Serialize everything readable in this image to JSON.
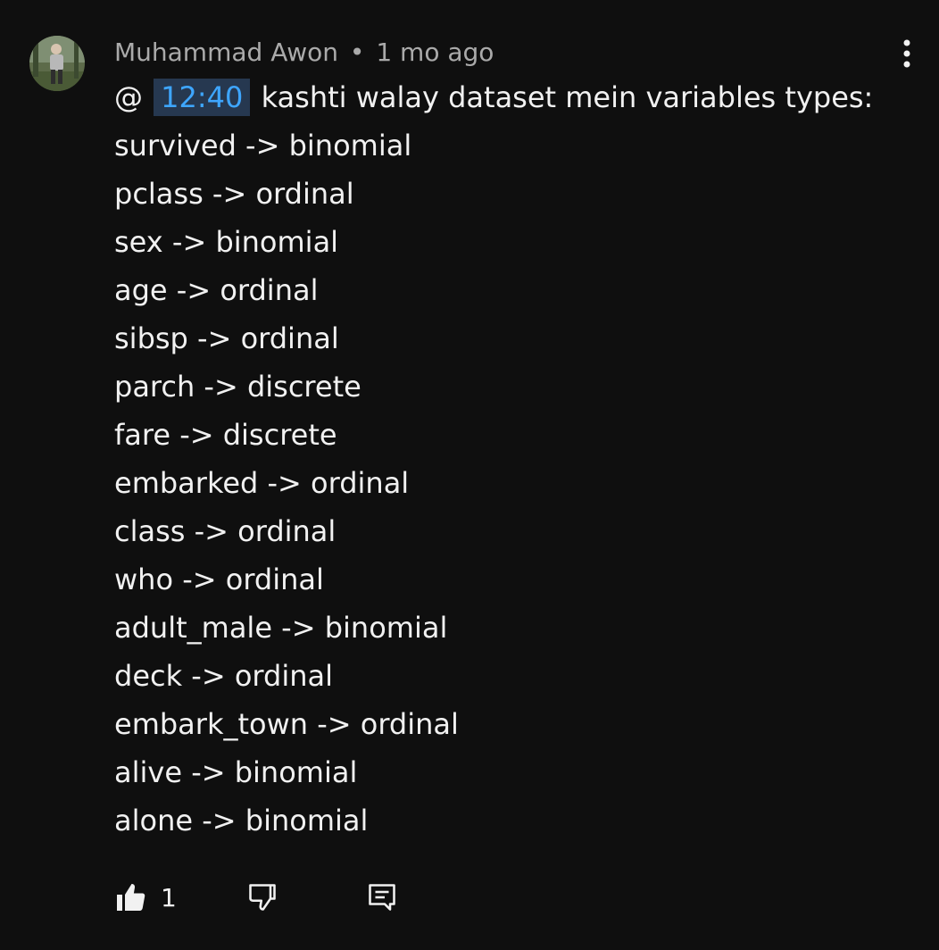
{
  "comment": {
    "author": "Muhammad Awon",
    "separator": "•",
    "time": "1 mo ago",
    "mention_prefix": "@",
    "timestamp_link": "12:40",
    "first_line_text": "kashti walay dataset mein variables types:",
    "lines": [
      "survived -> binomial",
      "pclass -> ordinal",
      "sex -> binomial",
      "age -> ordinal",
      "sibsp -> ordinal",
      "parch -> discrete",
      "fare -> discrete",
      "embarked -> ordinal",
      "class -> ordinal",
      "who -> ordinal",
      "adult_male -> binomial",
      "deck -> ordinal",
      "embark_town -> ordinal",
      "alive -> binomial",
      "alone -> binomial"
    ]
  },
  "actions": {
    "like_count": "1",
    "icons": [
      "thumbs-up-icon",
      "thumbs-down-icon",
      "reply-icon",
      "more-vertical-icon"
    ]
  },
  "colors": {
    "background": "#0f0f0f",
    "text": "#f1f1f1",
    "meta_text": "#aaaaaa",
    "link": "#3ea6ff",
    "link_background": "#263850"
  }
}
